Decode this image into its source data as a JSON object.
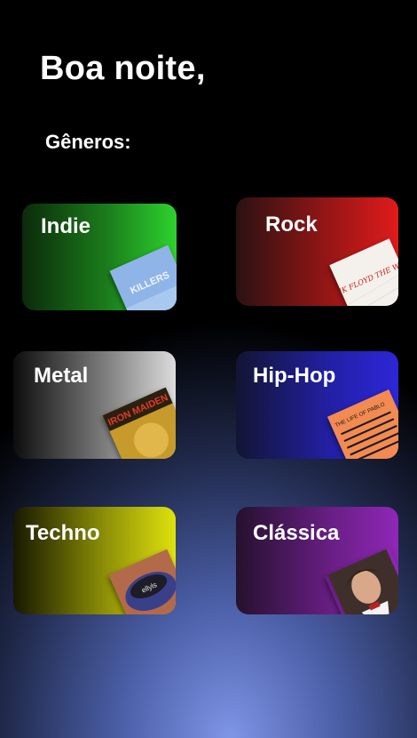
{
  "header": {
    "greeting": "Boa noite,"
  },
  "genres": {
    "title": "Gêneros:",
    "items": [
      {
        "label": "Indie"
      },
      {
        "label": "Rock"
      },
      {
        "label": "Metal"
      },
      {
        "label": "Hip-Hop"
      },
      {
        "label": "Techno"
      },
      {
        "label": "Clássica"
      }
    ]
  },
  "covers": {
    "indie_text": "KILLERS",
    "rock_text": "PINK FLOYD THE WALL",
    "metal_text": "IRON MAIDEN",
    "hiphop_text": "THE LIFE OF PABLO",
    "techno_text": "ellyls"
  }
}
